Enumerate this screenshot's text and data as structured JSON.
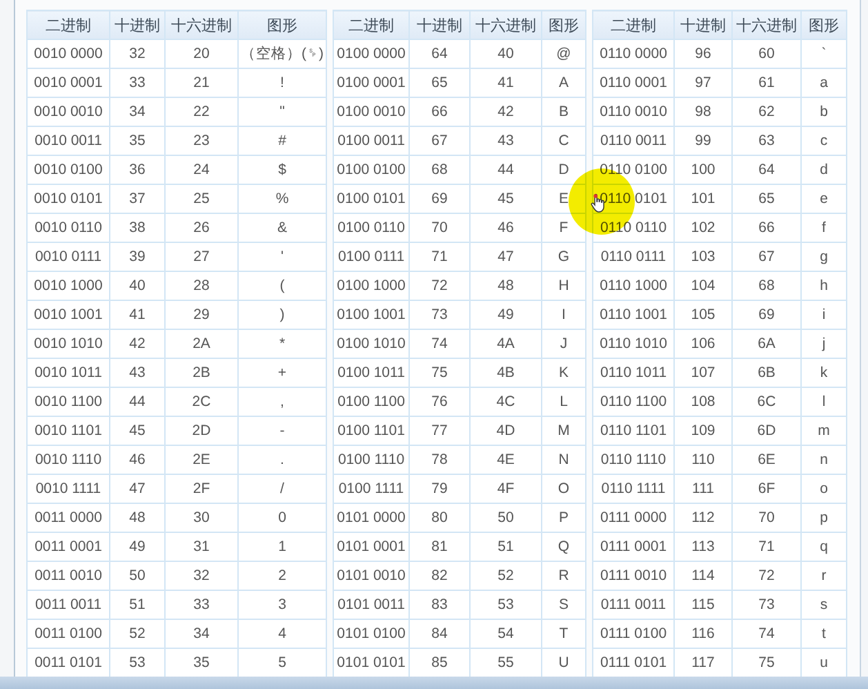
{
  "tables": [
    {
      "columns": [
        "二进制",
        "十进制",
        "十六进制",
        "图形"
      ],
      "rows": [
        [
          "0010 0000",
          "32",
          "20",
          "（空格）(␠)"
        ],
        [
          "0010 0001",
          "33",
          "21",
          "!"
        ],
        [
          "0010 0010",
          "34",
          "22",
          "\""
        ],
        [
          "0010 0011",
          "35",
          "23",
          "#"
        ],
        [
          "0010 0100",
          "36",
          "24",
          "$"
        ],
        [
          "0010 0101",
          "37",
          "25",
          "%"
        ],
        [
          "0010 0110",
          "38",
          "26",
          "&"
        ],
        [
          "0010 0111",
          "39",
          "27",
          "'"
        ],
        [
          "0010 1000",
          "40",
          "28",
          "("
        ],
        [
          "0010 1001",
          "41",
          "29",
          ")"
        ],
        [
          "0010 1010",
          "42",
          "2A",
          "*"
        ],
        [
          "0010 1011",
          "43",
          "2B",
          "+"
        ],
        [
          "0010 1100",
          "44",
          "2C",
          ","
        ],
        [
          "0010 1101",
          "45",
          "2D",
          "-"
        ],
        [
          "0010 1110",
          "46",
          "2E",
          "."
        ],
        [
          "0010 1111",
          "47",
          "2F",
          "/"
        ],
        [
          "0011 0000",
          "48",
          "30",
          "0"
        ],
        [
          "0011 0001",
          "49",
          "31",
          "1"
        ],
        [
          "0011 0010",
          "50",
          "32",
          "2"
        ],
        [
          "0011 0011",
          "51",
          "33",
          "3"
        ],
        [
          "0011 0100",
          "52",
          "34",
          "4"
        ],
        [
          "0011 0101",
          "53",
          "35",
          "5"
        ]
      ]
    },
    {
      "columns": [
        "二进制",
        "十进制",
        "十六进制",
        "图形"
      ],
      "rows": [
        [
          "0100 0000",
          "64",
          "40",
          "@"
        ],
        [
          "0100 0001",
          "65",
          "41",
          "A"
        ],
        [
          "0100 0010",
          "66",
          "42",
          "B"
        ],
        [
          "0100 0011",
          "67",
          "43",
          "C"
        ],
        [
          "0100 0100",
          "68",
          "44",
          "D"
        ],
        [
          "0100 0101",
          "69",
          "45",
          "E"
        ],
        [
          "0100 0110",
          "70",
          "46",
          "F"
        ],
        [
          "0100 0111",
          "71",
          "47",
          "G"
        ],
        [
          "0100 1000",
          "72",
          "48",
          "H"
        ],
        [
          "0100 1001",
          "73",
          "49",
          "I"
        ],
        [
          "0100 1010",
          "74",
          "4A",
          "J"
        ],
        [
          "0100 1011",
          "75",
          "4B",
          "K"
        ],
        [
          "0100 1100",
          "76",
          "4C",
          "L"
        ],
        [
          "0100 1101",
          "77",
          "4D",
          "M"
        ],
        [
          "0100 1110",
          "78",
          "4E",
          "N"
        ],
        [
          "0100 1111",
          "79",
          "4F",
          "O"
        ],
        [
          "0101 0000",
          "80",
          "50",
          "P"
        ],
        [
          "0101 0001",
          "81",
          "51",
          "Q"
        ],
        [
          "0101 0010",
          "82",
          "52",
          "R"
        ],
        [
          "0101 0011",
          "83",
          "53",
          "S"
        ],
        [
          "0101 0100",
          "84",
          "54",
          "T"
        ],
        [
          "0101 0101",
          "85",
          "55",
          "U"
        ]
      ]
    },
    {
      "columns": [
        "二进制",
        "十进制",
        "十六进制",
        "图形"
      ],
      "rows": [
        [
          "0110 0000",
          "96",
          "60",
          "`"
        ],
        [
          "0110 0001",
          "97",
          "61",
          "a"
        ],
        [
          "0110 0010",
          "98",
          "62",
          "b"
        ],
        [
          "0110 0011",
          "99",
          "63",
          "c"
        ],
        [
          "0110 0100",
          "100",
          "64",
          "d"
        ],
        [
          "0110 0101",
          "101",
          "65",
          "e"
        ],
        [
          "0110 0110",
          "102",
          "66",
          "f"
        ],
        [
          "0110 0111",
          "103",
          "67",
          "g"
        ],
        [
          "0110 1000",
          "104",
          "68",
          "h"
        ],
        [
          "0110 1001",
          "105",
          "69",
          "i"
        ],
        [
          "0110 1010",
          "106",
          "6A",
          "j"
        ],
        [
          "0110 1011",
          "107",
          "6B",
          "k"
        ],
        [
          "0110 1100",
          "108",
          "6C",
          "l"
        ],
        [
          "0110 1101",
          "109",
          "6D",
          "m"
        ],
        [
          "0110 1110",
          "110",
          "6E",
          "n"
        ],
        [
          "0110 1111",
          "111",
          "6F",
          "o"
        ],
        [
          "0111 0000",
          "112",
          "70",
          "p"
        ],
        [
          "0111 0001",
          "113",
          "71",
          "q"
        ],
        [
          "0111 0010",
          "114",
          "72",
          "r"
        ],
        [
          "0111 0011",
          "115",
          "73",
          "s"
        ],
        [
          "0111 0100",
          "116",
          "74",
          "t"
        ],
        [
          "0111 0101",
          "117",
          "75",
          "u"
        ]
      ]
    }
  ]
}
